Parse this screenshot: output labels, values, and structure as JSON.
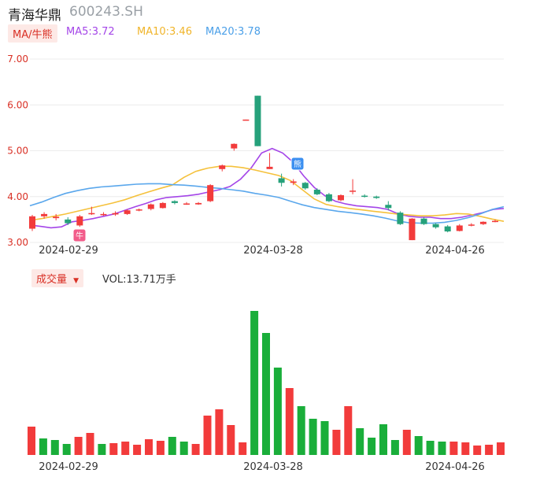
{
  "header": {
    "name": "青海华鼎",
    "code": "600243.SH"
  },
  "legend": {
    "tag": "MA/牛熊",
    "ma5": "MA5:3.72",
    "ma10": "MA10:3.46",
    "ma20": "MA20:3.78"
  },
  "volume": {
    "tag": "成交量",
    "label": "VOL:13.71万手"
  },
  "colors": {
    "up": "#f23b3b",
    "down": "#26a17b",
    "vol_up": "#f23b3b",
    "vol_down": "#1aae3a",
    "ma5": "#a445e8",
    "ma10": "#f5c13b",
    "ma20": "#5aa7ec",
    "axis": "#d93025"
  },
  "chart_data": [
    {
      "type": "candlestick",
      "y_ticks": [
        "7.00",
        "6.00",
        "5.00",
        "4.00",
        "3.00"
      ],
      "ylim": [
        3.0,
        7.0
      ],
      "x_labels": [
        "2024-02-29",
        "2024-03-28",
        "2024-04-26"
      ],
      "candles": [
        {
          "o": 3.3,
          "c": 3.57,
          "h": 3.6,
          "l": 3.25
        },
        {
          "o": 3.57,
          "c": 3.62,
          "h": 3.66,
          "l": 3.52
        },
        {
          "o": 3.53,
          "c": 3.56,
          "h": 3.62,
          "l": 3.48
        },
        {
          "o": 3.5,
          "c": 3.42,
          "h": 3.55,
          "l": 3.38
        },
        {
          "o": 3.37,
          "c": 3.57,
          "h": 3.6,
          "l": 3.34
        },
        {
          "o": 3.62,
          "c": 3.64,
          "h": 3.78,
          "l": 3.6
        },
        {
          "o": 3.62,
          "c": 3.62,
          "h": 3.66,
          "l": 3.58
        },
        {
          "o": 3.61,
          "c": 3.64,
          "h": 3.68,
          "l": 3.58
        },
        {
          "o": 3.62,
          "c": 3.7,
          "h": 3.72,
          "l": 3.6
        },
        {
          "o": 3.7,
          "c": 3.72,
          "h": 3.74,
          "l": 3.68
        },
        {
          "o": 3.73,
          "c": 3.83,
          "h": 3.85,
          "l": 3.7
        },
        {
          "o": 3.75,
          "c": 3.86,
          "h": 3.88,
          "l": 3.74
        },
        {
          "o": 3.9,
          "c": 3.86,
          "h": 3.92,
          "l": 3.83
        },
        {
          "o": 3.85,
          "c": 3.85,
          "h": 3.88,
          "l": 3.82
        },
        {
          "o": 3.83,
          "c": 3.86,
          "h": 3.88,
          "l": 3.82
        },
        {
          "o": 3.9,
          "c": 4.25,
          "h": 4.27,
          "l": 3.88
        },
        {
          "o": 4.6,
          "c": 4.68,
          "h": 4.7,
          "l": 4.55
        },
        {
          "o": 5.05,
          "c": 5.15,
          "h": 5.16,
          "l": 5.0
        },
        {
          "o": 5.67,
          "c": 5.68,
          "h": 5.68,
          "l": 5.67
        },
        {
          "o": 6.2,
          "c": 5.1,
          "h": 6.2,
          "l": 5.1
        },
        {
          "o": 4.6,
          "c": 4.65,
          "h": 4.95,
          "l": 4.6
        },
        {
          "o": 4.4,
          "c": 4.3,
          "h": 4.5,
          "l": 4.22
        },
        {
          "o": 4.3,
          "c": 4.33,
          "h": 4.38,
          "l": 4.25
        },
        {
          "o": 4.3,
          "c": 4.18,
          "h": 4.32,
          "l": 4.15
        },
        {
          "o": 4.15,
          "c": 4.05,
          "h": 4.18,
          "l": 4.03
        },
        {
          "o": 4.05,
          "c": 3.9,
          "h": 4.08,
          "l": 3.88
        },
        {
          "o": 3.92,
          "c": 4.03,
          "h": 4.05,
          "l": 3.9
        },
        {
          "o": 4.12,
          "c": 4.13,
          "h": 4.38,
          "l": 4.05
        },
        {
          "o": 4.02,
          "c": 4.0,
          "h": 4.05,
          "l": 3.98
        },
        {
          "o": 4.0,
          "c": 3.97,
          "h": 4.02,
          "l": 3.95
        },
        {
          "o": 3.82,
          "c": 3.75,
          "h": 3.9,
          "l": 3.7
        },
        {
          "o": 3.65,
          "c": 3.4,
          "h": 3.68,
          "l": 3.38
        },
        {
          "o": 3.05,
          "c": 3.52,
          "h": 3.53,
          "l": 3.05
        },
        {
          "o": 3.52,
          "c": 3.4,
          "h": 3.55,
          "l": 3.38
        },
        {
          "o": 3.4,
          "c": 3.33,
          "h": 3.42,
          "l": 3.3
        },
        {
          "o": 3.35,
          "c": 3.24,
          "h": 3.38,
          "l": 3.22
        },
        {
          "o": 3.25,
          "c": 3.37,
          "h": 3.4,
          "l": 3.24
        },
        {
          "o": 3.37,
          "c": 3.39,
          "h": 3.42,
          "l": 3.35
        },
        {
          "o": 3.4,
          "c": 3.45,
          "h": 3.46,
          "l": 3.38
        },
        {
          "o": 3.45,
          "c": 3.47,
          "h": 3.5,
          "l": 3.44
        }
      ],
      "series": [
        {
          "key": "ma5",
          "values": [
            3.38,
            3.35,
            3.32,
            3.34,
            3.45,
            3.48,
            3.52,
            3.57,
            3.62,
            3.7,
            3.78,
            3.85,
            3.93,
            3.98,
            4.0,
            4.02,
            4.05,
            4.1,
            4.15,
            4.22,
            4.38,
            4.62,
            4.95,
            5.05,
            4.95,
            4.75,
            4.45,
            4.2,
            4.02,
            3.9,
            3.84,
            3.8,
            3.78,
            3.76,
            3.72,
            3.62,
            3.57,
            3.55,
            3.55,
            3.52,
            3.52,
            3.55,
            3.6,
            3.65,
            3.72,
            3.74
          ]
        },
        {
          "key": "ma10",
          "values": [
            3.48,
            3.52,
            3.57,
            3.62,
            3.68,
            3.74,
            3.8,
            3.86,
            3.93,
            4.02,
            4.1,
            4.18,
            4.25,
            4.42,
            4.55,
            4.62,
            4.66,
            4.66,
            4.63,
            4.58,
            4.52,
            4.46,
            4.35,
            4.15,
            3.95,
            3.83,
            3.78,
            3.74,
            3.71,
            3.68,
            3.65,
            3.62,
            3.6,
            3.58,
            3.58,
            3.6,
            3.63,
            3.62,
            3.57,
            3.51,
            3.46
          ]
        },
        {
          "key": "ma20",
          "values": [
            3.8,
            3.88,
            3.98,
            4.07,
            4.13,
            4.18,
            4.21,
            4.23,
            4.25,
            4.27,
            4.28,
            4.28,
            4.26,
            4.25,
            4.23,
            4.2,
            4.18,
            4.15,
            4.12,
            4.07,
            4.03,
            3.98,
            3.9,
            3.82,
            3.76,
            3.72,
            3.68,
            3.65,
            3.62,
            3.58,
            3.53,
            3.47,
            3.43,
            3.42,
            3.42,
            3.44,
            3.48,
            3.54,
            3.62,
            3.72,
            3.78
          ]
        }
      ]
    },
    {
      "type": "bar",
      "title": "成交量",
      "x_labels": [
        "2024-02-29",
        "2024-03-28",
        "2024-04-26"
      ],
      "values": [
        3.6,
        2.1,
        1.9,
        1.4,
        2.3,
        2.8,
        1.4,
        1.5,
        1.7,
        1.3,
        2.0,
        1.8,
        2.3,
        1.7,
        1.4,
        5.0,
        5.8,
        3.8,
        1.6,
        18.3,
        15.5,
        11.1,
        8.5,
        6.2,
        4.6,
        4.3,
        3.2,
        6.2,
        3.4,
        2.2,
        3.9,
        1.9,
        3.2,
        2.4,
        1.8,
        1.7,
        1.7,
        1.6,
        1.2,
        1.3,
        1.6
      ],
      "up": [
        1,
        0,
        0,
        0,
        1,
        1,
        0,
        1,
        1,
        1,
        1,
        1,
        0,
        0,
        1,
        1,
        1,
        1,
        1,
        0,
        0,
        0,
        1,
        0,
        0,
        0,
        1,
        1,
        0,
        0,
        0,
        0,
        1,
        0,
        0,
        0,
        1,
        1,
        1,
        1,
        1
      ],
      "ylim": [
        0,
        18.3
      ]
    }
  ]
}
